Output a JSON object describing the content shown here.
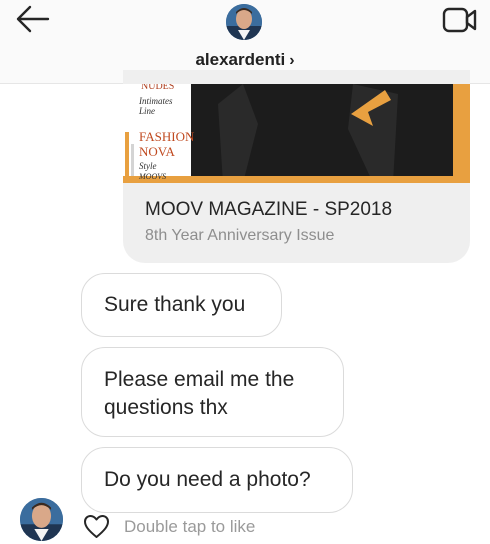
{
  "header": {
    "username": "alexardenti",
    "chevron": "›",
    "icons": {
      "back": "arrow-left-icon",
      "video": "video-camera-icon",
      "avatar": "profile-photo"
    }
  },
  "shared_card": {
    "image_text": {
      "nudes": "NUDES",
      "intimates": "Intimates",
      "line": "Line",
      "fashion": "FASHION",
      "nova": "NOVA",
      "style": "Style",
      "moovs": "MOOVS"
    },
    "title": "MOOV MAGAZINE - SP2018",
    "subtitle": "8th Year Anniversary Issue"
  },
  "messages": [
    {
      "lines": [
        "Sure thank you"
      ]
    },
    {
      "lines": [
        "Please email me the",
        "questions thx"
      ]
    },
    {
      "lines": [
        "Do you need a photo?"
      ]
    }
  ],
  "footer": {
    "like_hint": "Double tap to like",
    "like_icon": "heart-outline-icon"
  },
  "colors": {
    "header_bg": "#fafafa",
    "bubble_border": "#dbdbdb",
    "card_bg": "#efefef",
    "muted_text": "#8e8e8e",
    "image_orange": "#e8a040",
    "image_dark": "#1c1c1c"
  }
}
